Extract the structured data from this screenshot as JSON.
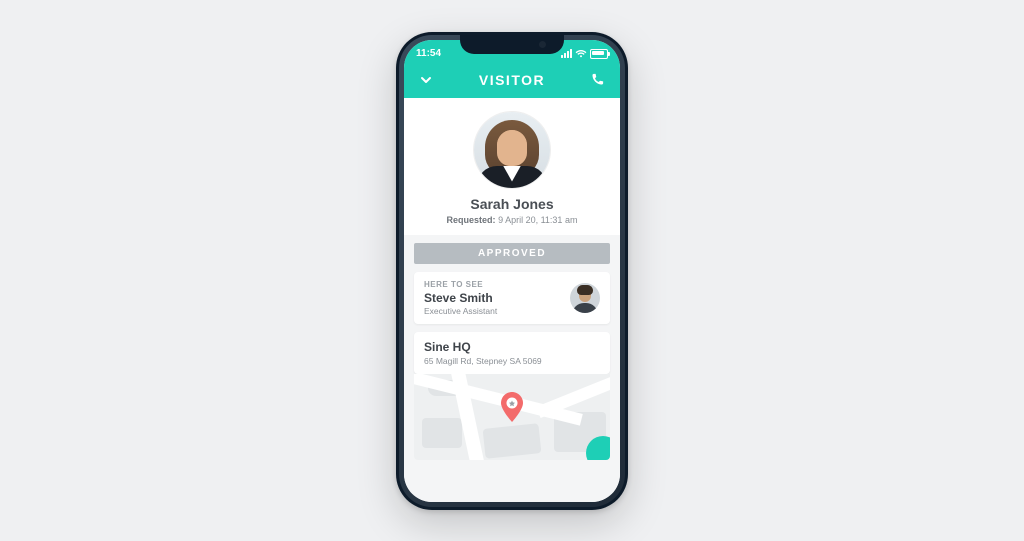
{
  "status": {
    "time": "11:54"
  },
  "header": {
    "title": "VISITOR"
  },
  "visitor": {
    "name": "Sarah Jones",
    "requested_label": "Requested:",
    "requested_value": "9 April 20, 11:31 am",
    "status": "APPROVED"
  },
  "host": {
    "section_label": "HERE TO SEE",
    "name": "Steve Smith",
    "role": "Executive Assistant"
  },
  "location": {
    "name": "Sine HQ",
    "address": "65 Magill Rd, Stepney SA 5069"
  }
}
